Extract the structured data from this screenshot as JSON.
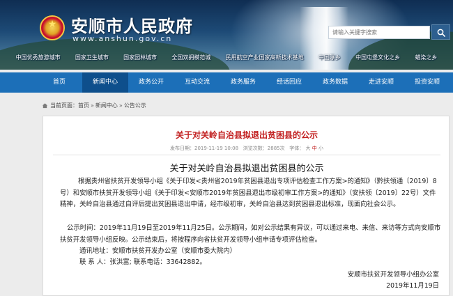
{
  "header": {
    "site_title": "安顺市人民政府",
    "site_url": "www.anshun.gov.cn",
    "search_placeholder": "请输入关键字搜索",
    "honors": [
      "中国优秀旅游城市",
      "国家卫生城市",
      "国家园林城市",
      "全国双拥模范城",
      "民用航空产业国家高新技术基地",
      "中国瀑乡",
      "中国屯堡文化之乡",
      "蜡染之乡"
    ]
  },
  "nav": {
    "items": [
      "首页",
      "新闻中心",
      "政务公开",
      "互动交流",
      "政务服务",
      "经话回应",
      "政务数据",
      "走进安顺",
      "投资安顺"
    ],
    "active_index": 1
  },
  "breadcrumb": {
    "prefix": "当前页面：",
    "items": [
      "首页",
      "新闻中心",
      "公告公示"
    ],
    "separator": "»"
  },
  "article": {
    "title": "关于对关岭自治县拟退出贫困县的公示",
    "meta_source_label": "发布日期：",
    "meta_date": "2019-11-19 10:08",
    "meta_views_label": "浏览次数：",
    "meta_views": "2885次",
    "meta_font_label": "字体：",
    "font_sizes": [
      "大",
      "中",
      "小"
    ],
    "body_title": "关于对关岭自治县拟退出贫困县的公示",
    "paragraphs": [
      "根据贵州省扶贫开发领导小组《关于印发<贵州省2019年贫困县退出专项评估检查工作方案>的通知》（黔扶领通〔2019〕8号）和安顺市扶贫开发领导小组《关于印发<安顺市2019年贫困县退出市级初审工作方案>的通知》（安扶领〔2019〕22号）文件精神，关岭自治县通过自评后提出贫困县退出申请，经市级初审，关岭自治县达到贫困县退出标准，现面向社会公示。",
      "公示时间：2019年11月19日至2019年11月25日。公示期间，如对公示结果有异议，可以通过来电、来信、来访等方式向安顺市扶贫开发领导小组反映。公示结束后，将按程序向省扶贫开发领导小组申请专项评估检查。",
      "通讯地址：安顺市扶贫开发办公室（安顺市委大院内）",
      "联  系  人：张洪富; 联系电话：33642882。"
    ],
    "signature_org": "安顺市扶贫开发领导小组办公室",
    "signature_date": "2019年11月19日"
  },
  "colors": {
    "nav_bg": "#1c6fb8",
    "nav_active": "#0e4f8c",
    "title_red": "#c21f1f"
  }
}
